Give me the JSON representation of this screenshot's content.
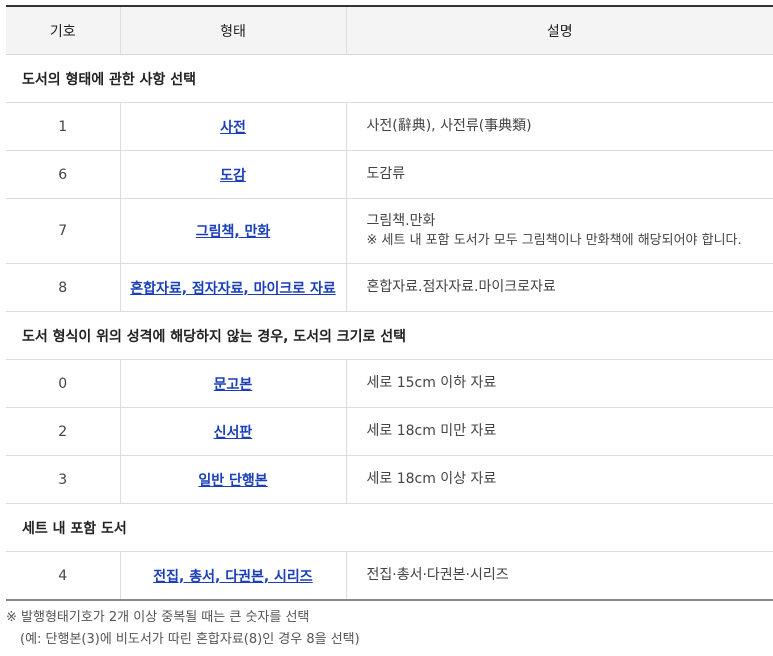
{
  "headers": {
    "code": "기호",
    "form": "형태",
    "desc": "설명"
  },
  "sections": [
    {
      "title": "도서의 형태에 관한 사항 선택",
      "rows": [
        {
          "code": "1",
          "form": "사전",
          "desc": "사전(辭典), 사전류(事典類)",
          "note": ""
        },
        {
          "code": "6",
          "form": "도감",
          "desc": "도감류",
          "note": ""
        },
        {
          "code": "7",
          "form": "그림책, 만화",
          "desc": "그림책.만화",
          "note": "※ 세트 내 포함 도서가 모두 그림책이나 만화책에 해당되어야 합니다."
        },
        {
          "code": "8",
          "form": "혼합자료, 점자자료, 마이크로 자료",
          "desc": "혼합자료.점자자료.마이크로자료",
          "note": ""
        }
      ]
    },
    {
      "title": "도서 형식이 위의 성격에 해당하지 않는 경우, 도서의 크기로 선택",
      "rows": [
        {
          "code": "0",
          "form": "문고본",
          "desc": "세로 15cm 이하 자료",
          "note": ""
        },
        {
          "code": "2",
          "form": "신서판",
          "desc": "세로 18cm 미만 자료",
          "note": ""
        },
        {
          "code": "3",
          "form": "일반 단행본",
          "desc": "세로 18cm 이상 자료",
          "note": ""
        }
      ]
    },
    {
      "title": "세트 내 포함 도서",
      "rows": [
        {
          "code": "4",
          "form": "전집, 총서, 다권본, 시리즈",
          "desc": "전집·총서·다권본·시리즈",
          "note": ""
        }
      ]
    }
  ],
  "footnote": {
    "line1": "※ 발행형태기호가 2개 이상 중복될 때는 큰 숫자를 선택",
    "line2": "(예: 단행본(3)에 비도서가 따린 혼합자료(8)인 경우 8을 선택)"
  },
  "colors": {
    "link": "#1a3fb8",
    "header_bg": "#f4f4f4",
    "border": "#dddddd"
  }
}
